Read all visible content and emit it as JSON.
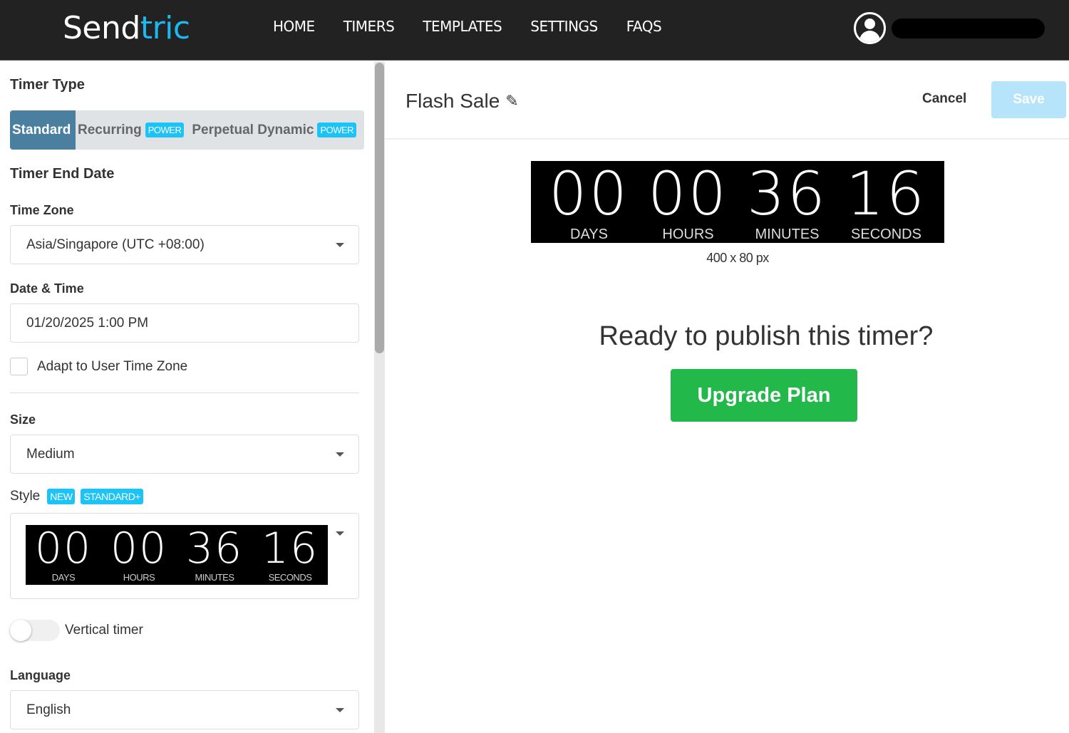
{
  "header": {
    "logo_part1": "Send",
    "logo_part2": "tric",
    "nav": [
      "HOME",
      "TIMERS",
      "TEMPLATES",
      "SETTINGS",
      "FAQS"
    ],
    "user_icon": "user-circle-icon"
  },
  "sidebar": {
    "timer_type_heading": "Timer Type",
    "timer_types": [
      {
        "label": "Standard",
        "active": true,
        "badge": null
      },
      {
        "label": "Recurring",
        "active": false,
        "badge": "POWER"
      },
      {
        "label": "Perpetual Dynamic",
        "active": false,
        "badge": "POWER"
      }
    ],
    "end_date_heading": "Timer End Date",
    "time_zone_label": "Time Zone",
    "time_zone_value": "Asia/Singapore (UTC +08:00)",
    "date_time_label": "Date & Time",
    "date_time_value": "01/20/2025 1:00 PM",
    "adapt_label": "Adapt to User Time Zone",
    "adapt_checked": false,
    "size_label": "Size",
    "size_value": "Medium",
    "style_label": "Style",
    "style_badges": [
      "NEW",
      "STANDARD+"
    ],
    "style_preview": {
      "units": [
        {
          "value": "00",
          "label": "DAYS"
        },
        {
          "value": "00",
          "label": "HOURS"
        },
        {
          "value": "36",
          "label": "MINUTES"
        },
        {
          "value": "16",
          "label": "SECONDS"
        }
      ]
    },
    "vertical_timer_label": "Vertical timer",
    "vertical_timer_on": false,
    "language_label": "Language",
    "language_value": "English"
  },
  "main": {
    "timer_name": "Flash Sale",
    "cancel_label": "Cancel",
    "save_label": "Save",
    "preview": {
      "units": [
        {
          "value": "00",
          "label": "DAYS"
        },
        {
          "value": "00",
          "label": "HOURS"
        },
        {
          "value": "36",
          "label": "MINUTES"
        },
        {
          "value": "16",
          "label": "SECONDS"
        }
      ],
      "dimensions": "400 x 80 px"
    },
    "publish_prompt": "Ready to publish this timer?",
    "upgrade_label": "Upgrade Plan"
  },
  "colors": {
    "accent": "#1cb8f0",
    "active_tab": "#4a7fa0",
    "badge": "#1cc3f7",
    "upgrade": "#22b84a",
    "save_disabled": "#b6e4fb",
    "topbar": "#222222"
  }
}
